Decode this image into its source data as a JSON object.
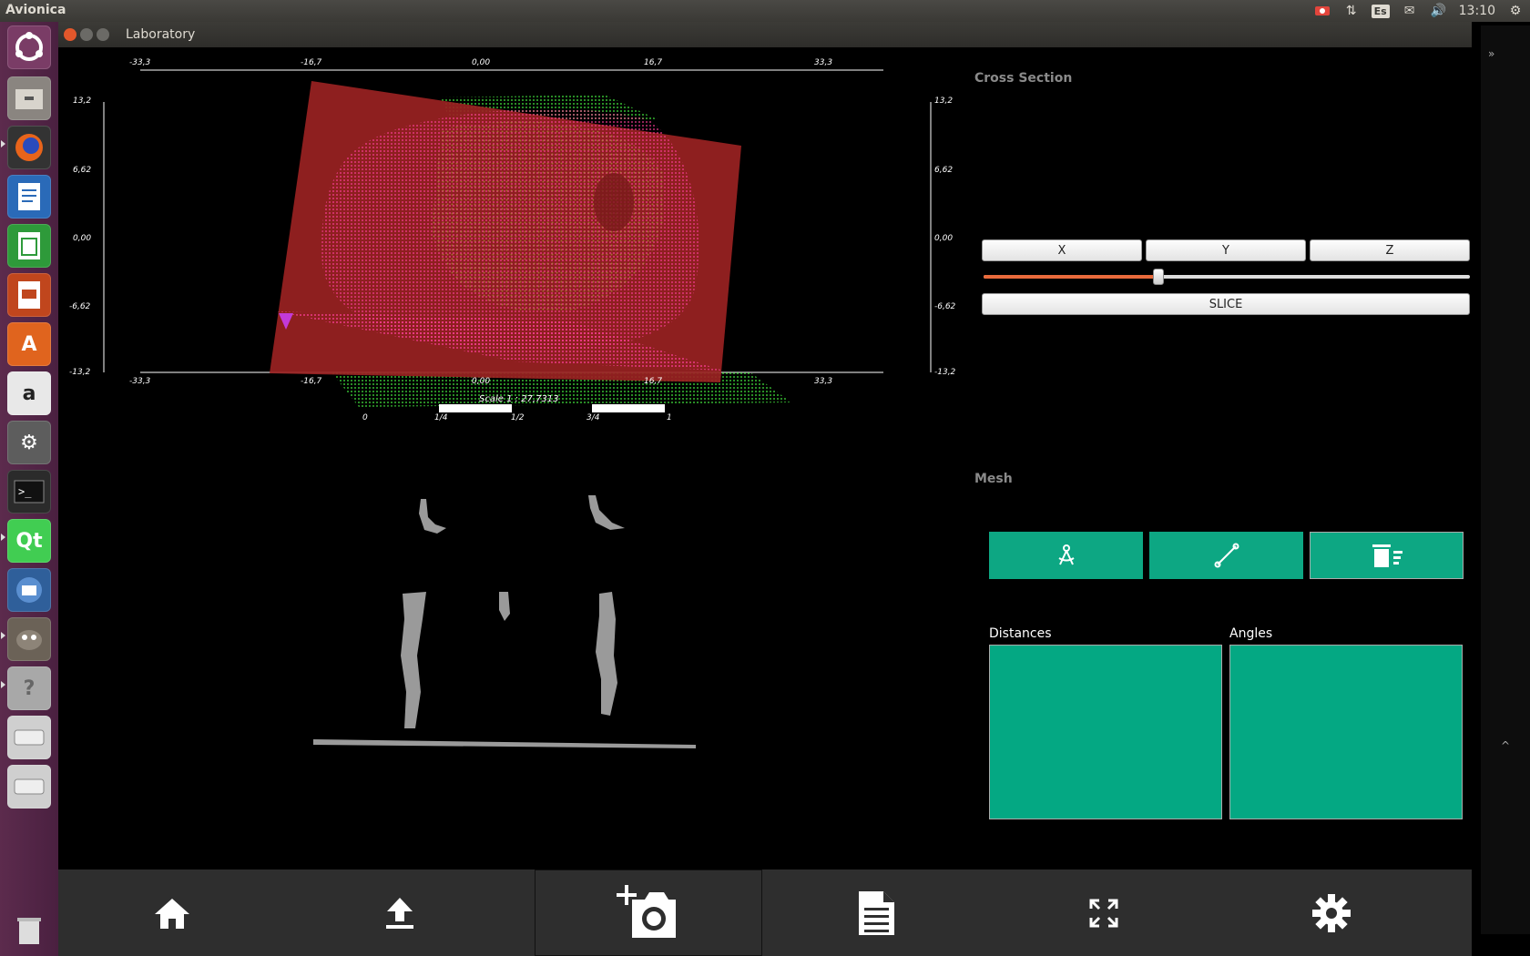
{
  "topbar": {
    "app_name": "Avionica",
    "language": "Es",
    "clock": "13:10"
  },
  "launcher": {
    "items": [
      "dash-home",
      "files",
      "firefox",
      "writer",
      "calc",
      "impress",
      "software-center",
      "amazon",
      "system-settings",
      "terminal",
      "qt-creator",
      "thunderbird",
      "gimp",
      "help",
      "drive-1",
      "drive-2",
      "trash"
    ]
  },
  "window": {
    "title": "Laboratory"
  },
  "viewport": {
    "x_ticks": [
      "-33,3",
      "-16,7",
      "0,00",
      "16,7",
      "33,3"
    ],
    "y_ticks": [
      "13,2",
      "6,62",
      "0,00",
      "-6,62",
      "-13,2"
    ],
    "scale_label": "Scale 1 : 27,7313",
    "scale_ticks": [
      "0",
      "1/4",
      "1/2",
      "3/4",
      "1"
    ]
  },
  "cross_section": {
    "title": "Cross Section",
    "axis_buttons": [
      "X",
      "Y",
      "Z"
    ],
    "slider_value": 0.36,
    "slice_label": "SLICE"
  },
  "mesh": {
    "title": "Mesh",
    "buttons": [
      "compass-icon",
      "line-measure-icon",
      "delete-list-icon"
    ]
  },
  "lists": {
    "distances_label": "Distances",
    "angles_label": "Angles"
  },
  "toolbar": {
    "buttons": [
      "home-icon",
      "upload-icon",
      "add-snapshot-icon",
      "document-icon",
      "fullscreen-icon",
      "settings-icon"
    ]
  },
  "colors": {
    "accent": "#0da783",
    "slider": "#e96a3b",
    "plane": "#9a2222",
    "points_pink": "#ff2a8a",
    "points_green": "#33cc33"
  }
}
